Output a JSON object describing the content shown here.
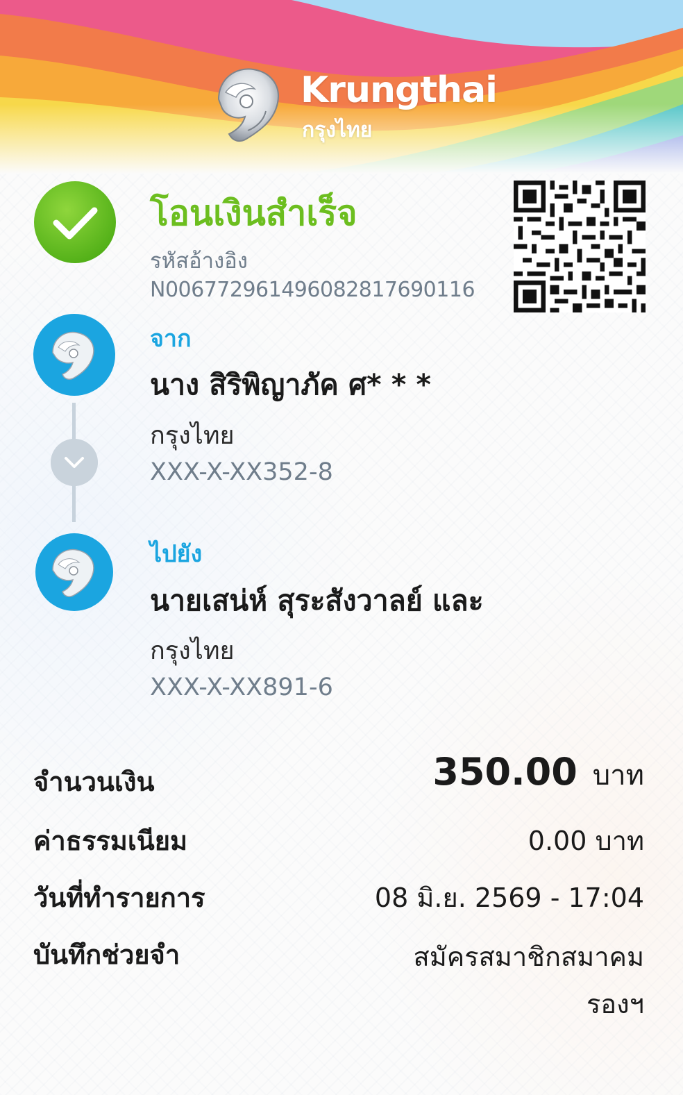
{
  "header": {
    "brand_en": "Krungthai",
    "brand_th": "กรุงไทย"
  },
  "status": {
    "title": "โอนเงินสำเร็จ",
    "ref_label": "รหัสอ้างอิง",
    "ref_value": "N006772961496082817690116"
  },
  "qr": {
    "icon": "qr-code-icon"
  },
  "from": {
    "label": "จาก",
    "name": "นาง สิริพิญาภัค ศ* * *",
    "bank": "กรุงไทย",
    "account": "XXX-X-XX352-8",
    "icon": "krungthai-bank-icon"
  },
  "to": {
    "label": "ไปยัง",
    "name": "นายเสน่ห์ สุระสังวาลย์ และ",
    "bank": "กรุงไทย",
    "account": "XXX-X-XX891-6",
    "icon": "krungthai-bank-icon"
  },
  "details": {
    "amount_label": "จำนวนเงิน",
    "amount_value": "350.00",
    "amount_unit": "บาท",
    "fee_label": "ค่าธรรมเนียม",
    "fee_value": "0.00 บาท",
    "date_label": "วันที่ทำรายการ",
    "date_value": "08 มิ.ย. 2569 - 17:04",
    "memo_label": "บันทึกช่วยจำ",
    "memo_value_line1": "สมัครสมาชิกสมาคม",
    "memo_value_line2": "รองฯ"
  },
  "colors": {
    "success_green": "#6cbe1f",
    "accent_blue": "#1ba5e0",
    "muted_gray": "#6f7d8b"
  }
}
